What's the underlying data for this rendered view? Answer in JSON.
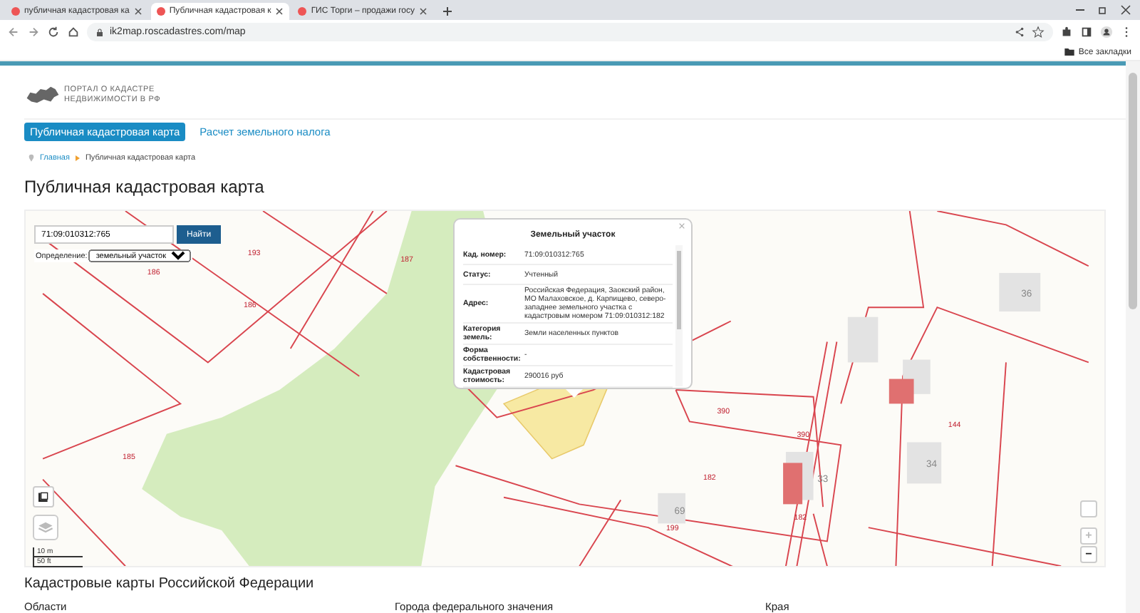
{
  "browser": {
    "tabs": [
      {
        "title": "публичная кадастровая ка",
        "selected": false
      },
      {
        "title": "Публичная кадастровая к",
        "selected": true
      },
      {
        "title": "ГИС Торги – продажи госу",
        "selected": false
      }
    ],
    "address": "ik2map.roscadastres.com/map",
    "bookmarks": [
      "Все закладки"
    ]
  },
  "logo": {
    "line_1": "ПОРТАЛ О КАДАСТРЕ",
    "line_2": "НЕДВИЖИМОСТИ В РФ"
  },
  "nav": [
    {
      "label": "Публичная кадастровая карта",
      "selected": true
    },
    {
      "label": "Расчет земельного налога",
      "selected": false
    }
  ],
  "breadcrumb": [
    "Главная",
    "Публичная кадастровая карта"
  ],
  "page_title": "Публичная кадастровая карта",
  "map": {
    "search": {
      "value": "71:09:010312:765",
      "button": "Найти"
    },
    "definition": {
      "label": "Определение:",
      "value": "земельный участок"
    },
    "labels": [
      "186",
      "193",
      "187",
      "186",
      "185",
      "390",
      "390",
      "182",
      "182",
      "199",
      "144",
      "36",
      "34",
      "69",
      "33"
    ],
    "popup": {
      "title": "Земельный участок",
      "rows": [
        {
          "label": "Кад. номер:",
          "value": "71:09:010312:765"
        },
        {
          "label": "Статус:",
          "value": "Учтенный"
        },
        {
          "label": "Адрес:",
          "value": "Российская Федерация, Заокский район, МО Малаховское, д. Карпищево, северо-западнее земельного участка с кадастровым номером 71:09:010312:182"
        },
        {
          "label": "Категория земель:",
          "value": "Земли населенных пунктов"
        },
        {
          "label": "Форма собственности:",
          "value": "-"
        },
        {
          "label": "Кадастровая стоимость:",
          "value": "290016 руб"
        }
      ]
    },
    "scale": [
      "10 m",
      "50 ft"
    ],
    "zoom": [
      "+",
      "−"
    ]
  },
  "section_title": "Кадастровые карты Российской Федерации",
  "columns": [
    "Области",
    "Города федерального значения",
    "Края"
  ]
}
